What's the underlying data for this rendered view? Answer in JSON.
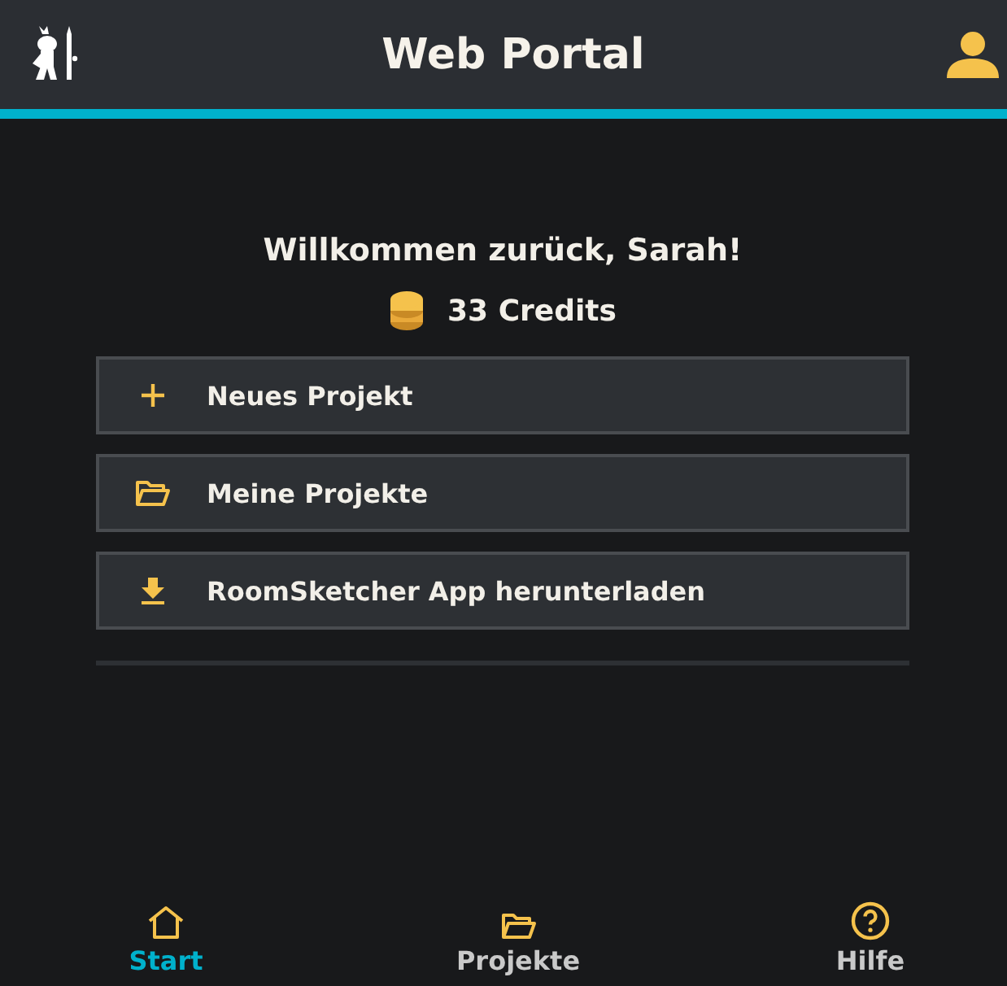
{
  "header": {
    "title": "Web Portal"
  },
  "welcome": "Willkommen zurück, Sarah!",
  "credits": "33 Credits",
  "actions": [
    {
      "kind": "plus",
      "label": "Neues Projekt"
    },
    {
      "kind": "folder",
      "label": "Meine Projekte"
    },
    {
      "kind": "download",
      "label": "RoomSketcher App herunterladen"
    }
  ],
  "nav": [
    {
      "kind": "home",
      "label": "Start",
      "selected": true
    },
    {
      "kind": "folder",
      "label": "Projekte",
      "selected": false
    },
    {
      "kind": "help",
      "label": "Hilfe",
      "selected": false
    }
  ]
}
